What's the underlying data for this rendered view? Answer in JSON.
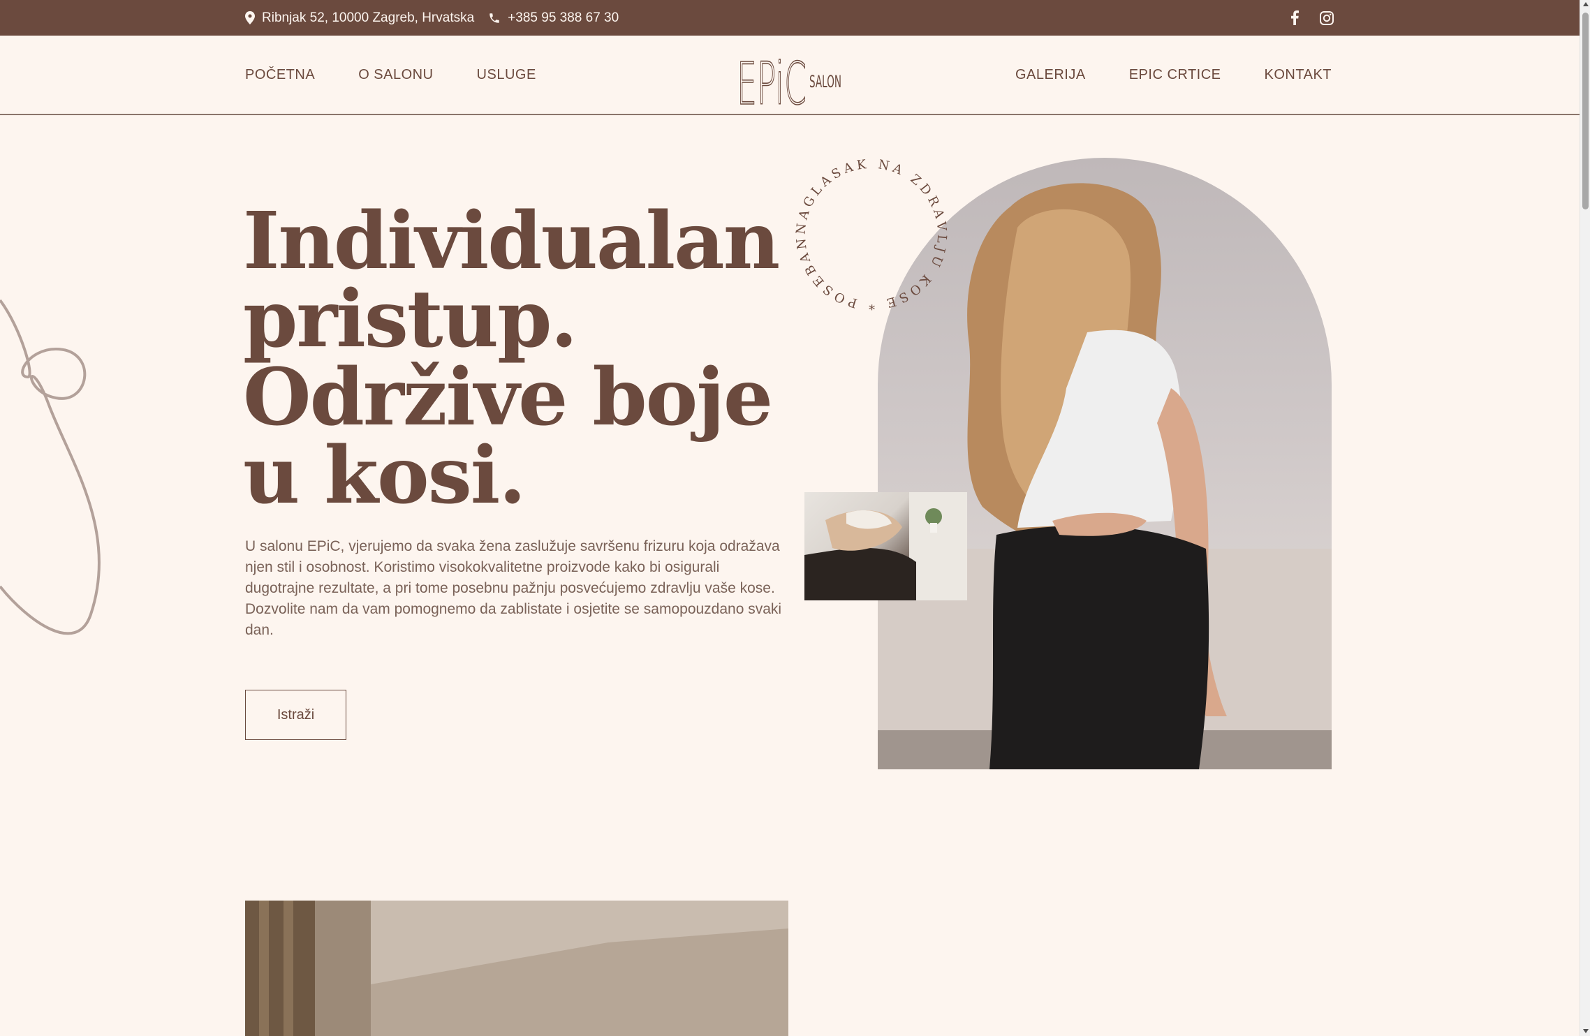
{
  "topbar": {
    "address": "Ribnjak 52, 10000 Zagreb, Hrvatska",
    "phone": "+385 95 388 67 30",
    "address_icon": "location-pin-icon",
    "phone_icon": "phone-icon",
    "social": [
      "facebook-icon",
      "instagram-icon"
    ]
  },
  "nav": {
    "left": [
      "POČETNA",
      "O SALONU",
      "USLUGE"
    ],
    "right": [
      "GALERIJA",
      "EPIC CRTICE",
      "KONTAKT"
    ]
  },
  "logo": {
    "main": "EPiC",
    "sub": "SALON"
  },
  "hero": {
    "headline_lines": [
      "Individualan",
      "pristup.",
      "Održive boje",
      "u kosi."
    ],
    "intro": "U salonu EPiC, vjerujemo da svaka žena zaslužuje savršenu frizuru koja odražava njen stil i osobnost. Koristimo visokokvalitetne proizvode kako bi osigurali dugotrajne rezultate, a pri tome posebnu pažnju posvećujemo zdravlju vaše kose. Dozvolite nam da vam pomognemo da zablistate i osjetite se samopouzdano svaki dan.",
    "cta_label": "Istraži",
    "circle_text": "NAGLASAK NA ZDRAVLJU KOSE * POSEBAN "
  },
  "colors": {
    "brand": "#6b4a3e",
    "background": "#fdf5ef"
  }
}
